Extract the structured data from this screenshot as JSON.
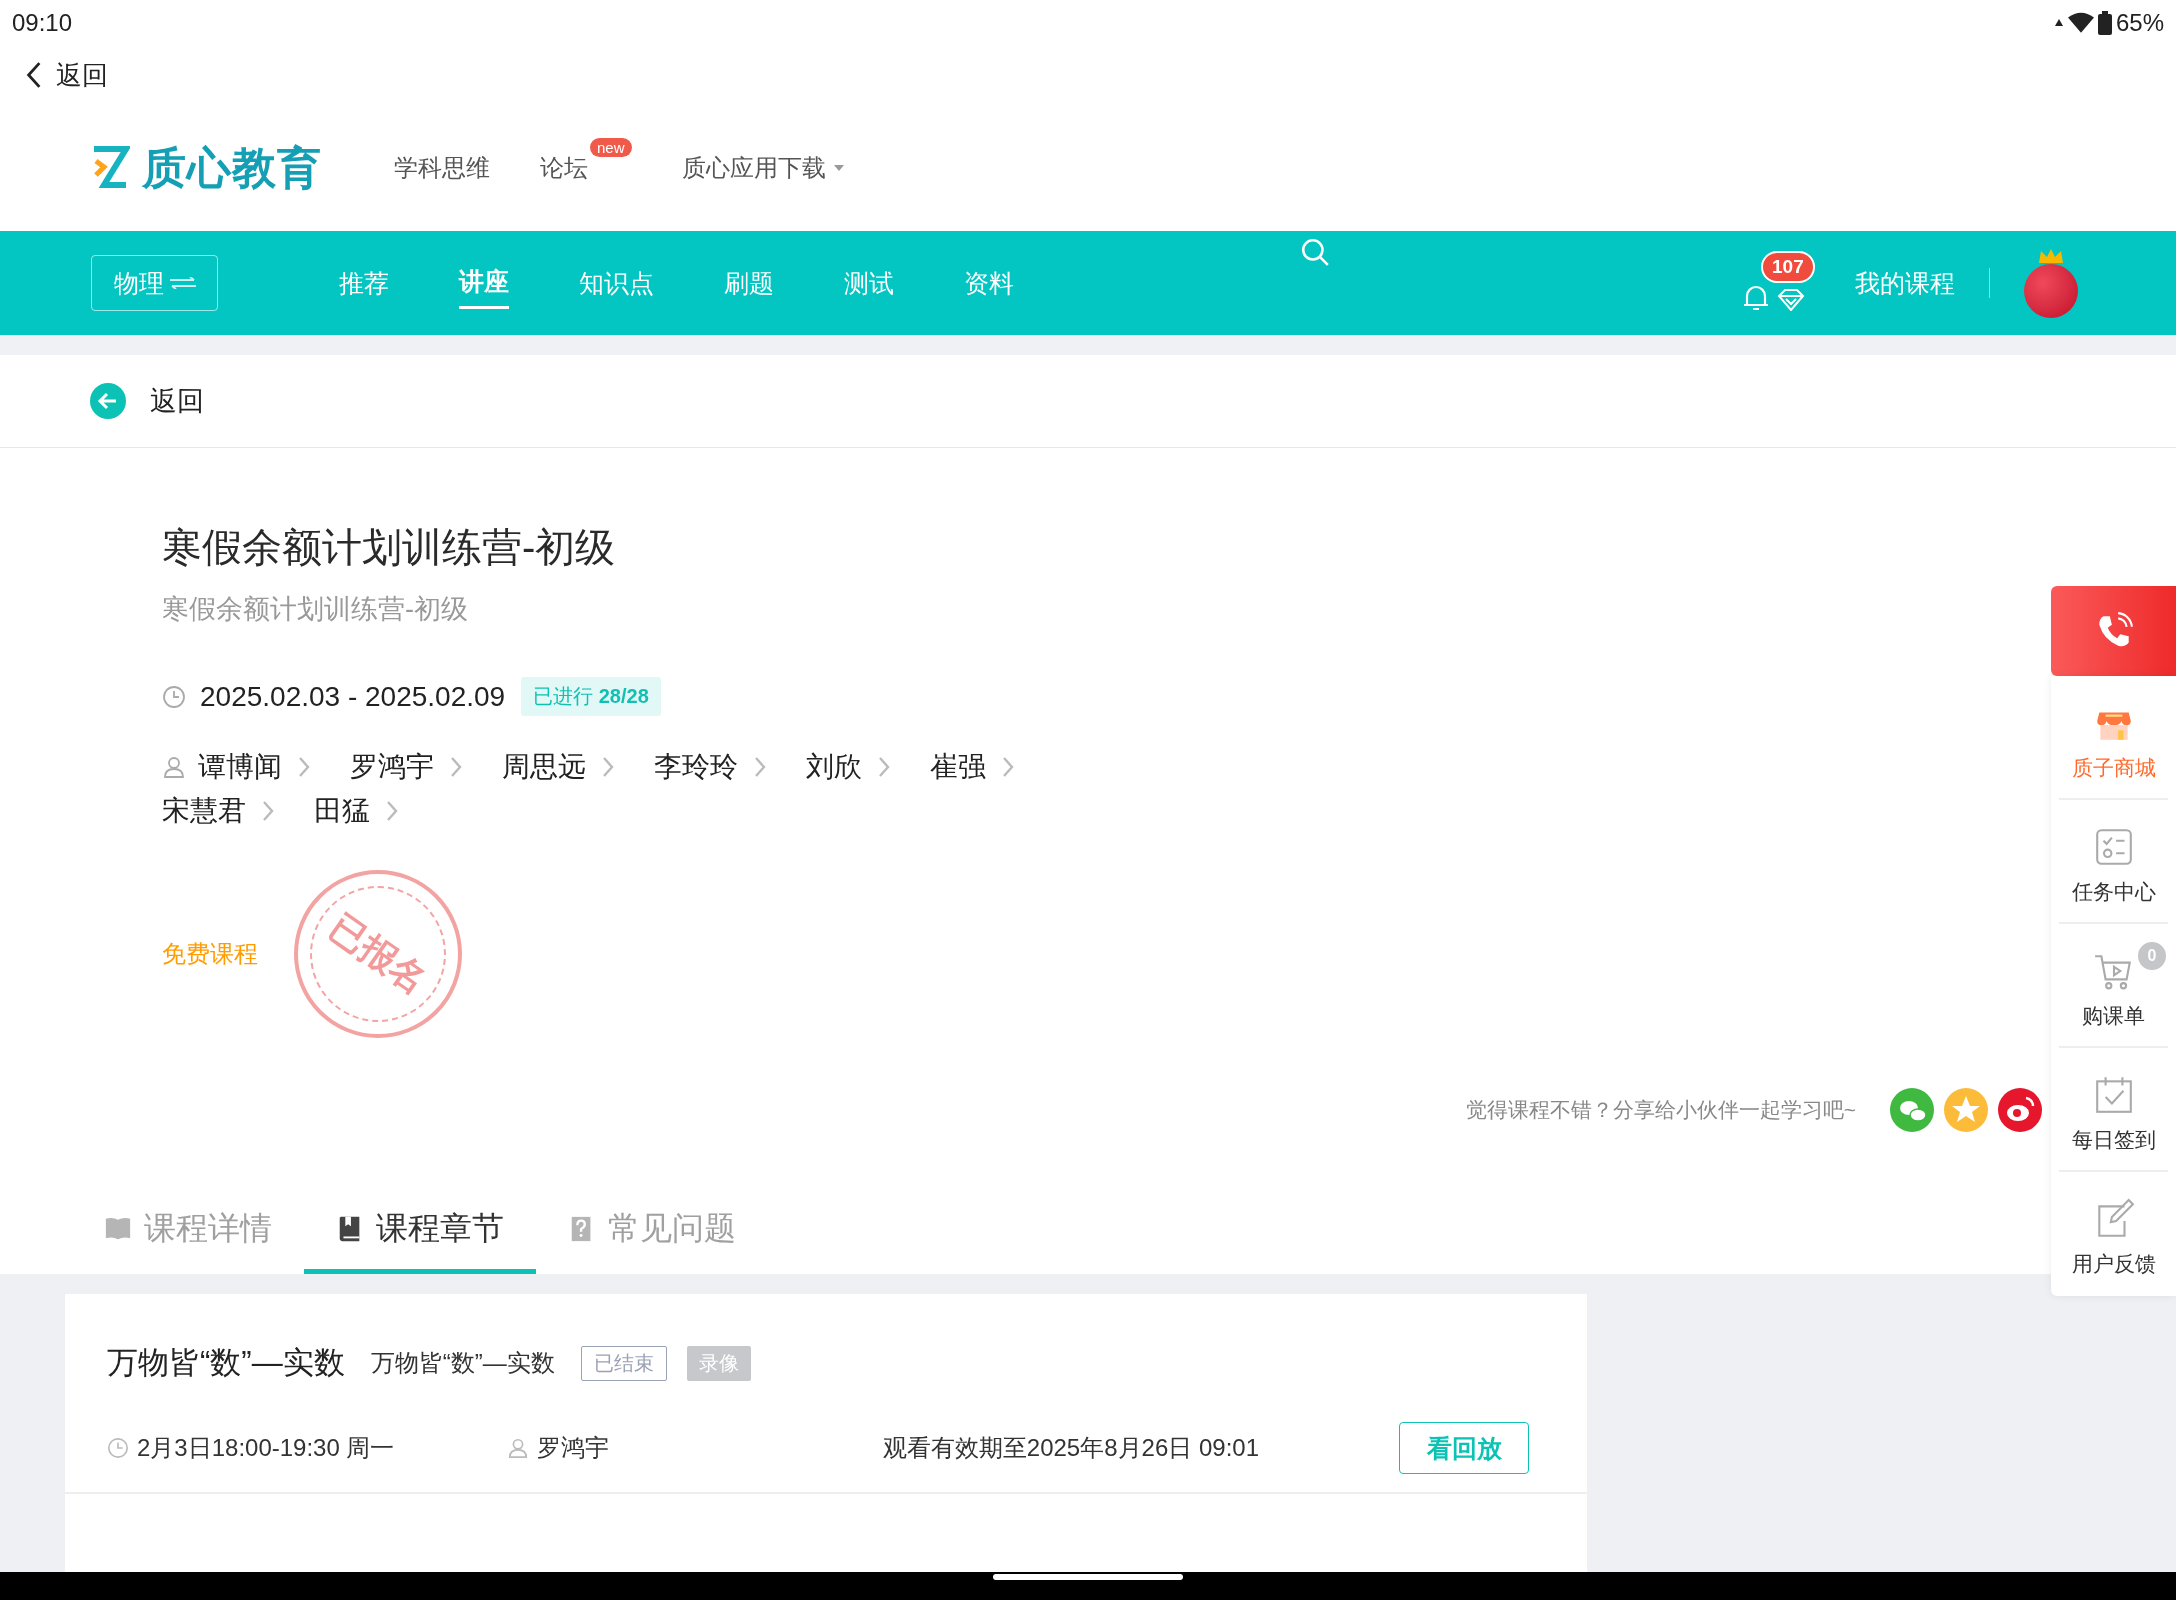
{
  "status_bar": {
    "time": "09:10",
    "battery": "65%"
  },
  "top_back": {
    "label": "返回"
  },
  "header": {
    "logo": "质心教育",
    "links": [
      {
        "label": "学科思维",
        "dropdown": false
      },
      {
        "label": "论坛",
        "badge": "new",
        "dropdown": false
      },
      {
        "label": "质心应用下载",
        "dropdown": true
      }
    ]
  },
  "nav": {
    "subject": "物理",
    "items": [
      {
        "label": "推荐",
        "selected": false
      },
      {
        "label": "讲座",
        "selected": true
      },
      {
        "label": "知识点",
        "selected": false
      },
      {
        "label": "刷题",
        "selected": false
      },
      {
        "label": "测试",
        "selected": false
      },
      {
        "label": "资料",
        "selected": false
      }
    ],
    "notifications": "107",
    "my_courses": "我的课程"
  },
  "page_back": {
    "label": "返回"
  },
  "course": {
    "title": "寒假余额计划训练营-初级",
    "subtitle": "寒假余额计划训练营-初级",
    "dates": "2025.02.03 - 2025.02.09",
    "progress": "已进行 **28/28**",
    "teachers": [
      "谭博闻",
      "罗鸿宇",
      "周思远",
      "李玲玲",
      "刘欣",
      "崔强",
      "宋慧君",
      "田猛"
    ],
    "price": "免费课程",
    "stamp": "已报名",
    "share_prompt": "觉得课程不错？分享给小伙伴一起学习吧~"
  },
  "tabs": [
    {
      "label": "课程详情",
      "selected": false
    },
    {
      "label": "课程章节",
      "selected": true
    },
    {
      "label": "常见问题",
      "selected": false
    }
  ],
  "chapters": [
    {
      "title": "万物皆“数”—实数",
      "subtitle": "万物皆“数”—实数",
      "status": "已结束",
      "type": "录像",
      "time": "2月3日18:00-19:30 周一",
      "teacher": "罗鸿宇",
      "expiry": "观看有效期至2025年8月26日 09:01",
      "action": "看回放"
    }
  ],
  "dock": {
    "items": [
      {
        "label": "质子商城",
        "selected": true
      },
      {
        "label": "任务中心",
        "selected": false
      },
      {
        "label": "购课单",
        "selected": false,
        "badge": "0"
      },
      {
        "label": "每日签到",
        "selected": false
      },
      {
        "label": "用户反馈",
        "selected": false
      }
    ]
  }
}
